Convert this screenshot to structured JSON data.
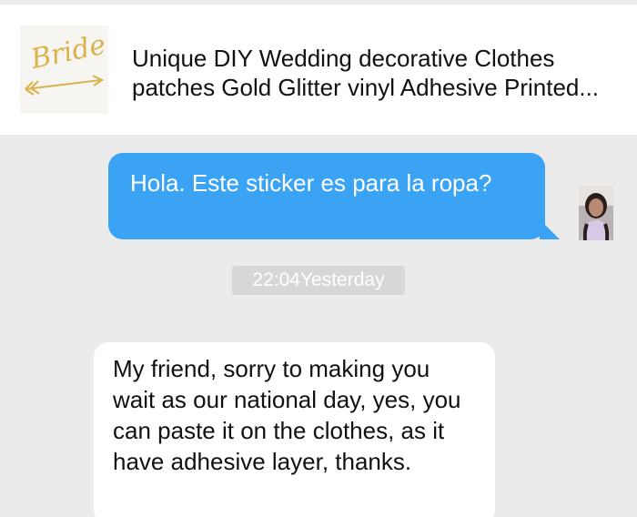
{
  "product": {
    "image_label": "Bride",
    "title": "Unique DIY Wedding decorative Clothes patches Gold Glitter vinyl Adhesive Printed..."
  },
  "messages": {
    "outgoing_text": "Hola. Este sticker es para la ropa?",
    "timestamp": "22:04Yesterday",
    "incoming_text": "My friend, sorry to making you wait as our national day, yes, you can paste it on the clothes, as it have adhesive layer, thanks."
  },
  "colors": {
    "outgoing_bubble": "#3aa3f3",
    "incoming_bubble": "#ffffff",
    "background": "#ebebeb",
    "timestamp_pill": "#d7d7d7",
    "gold": "#d9b24c"
  },
  "icons": {
    "avatar": "user-avatar-photo"
  }
}
